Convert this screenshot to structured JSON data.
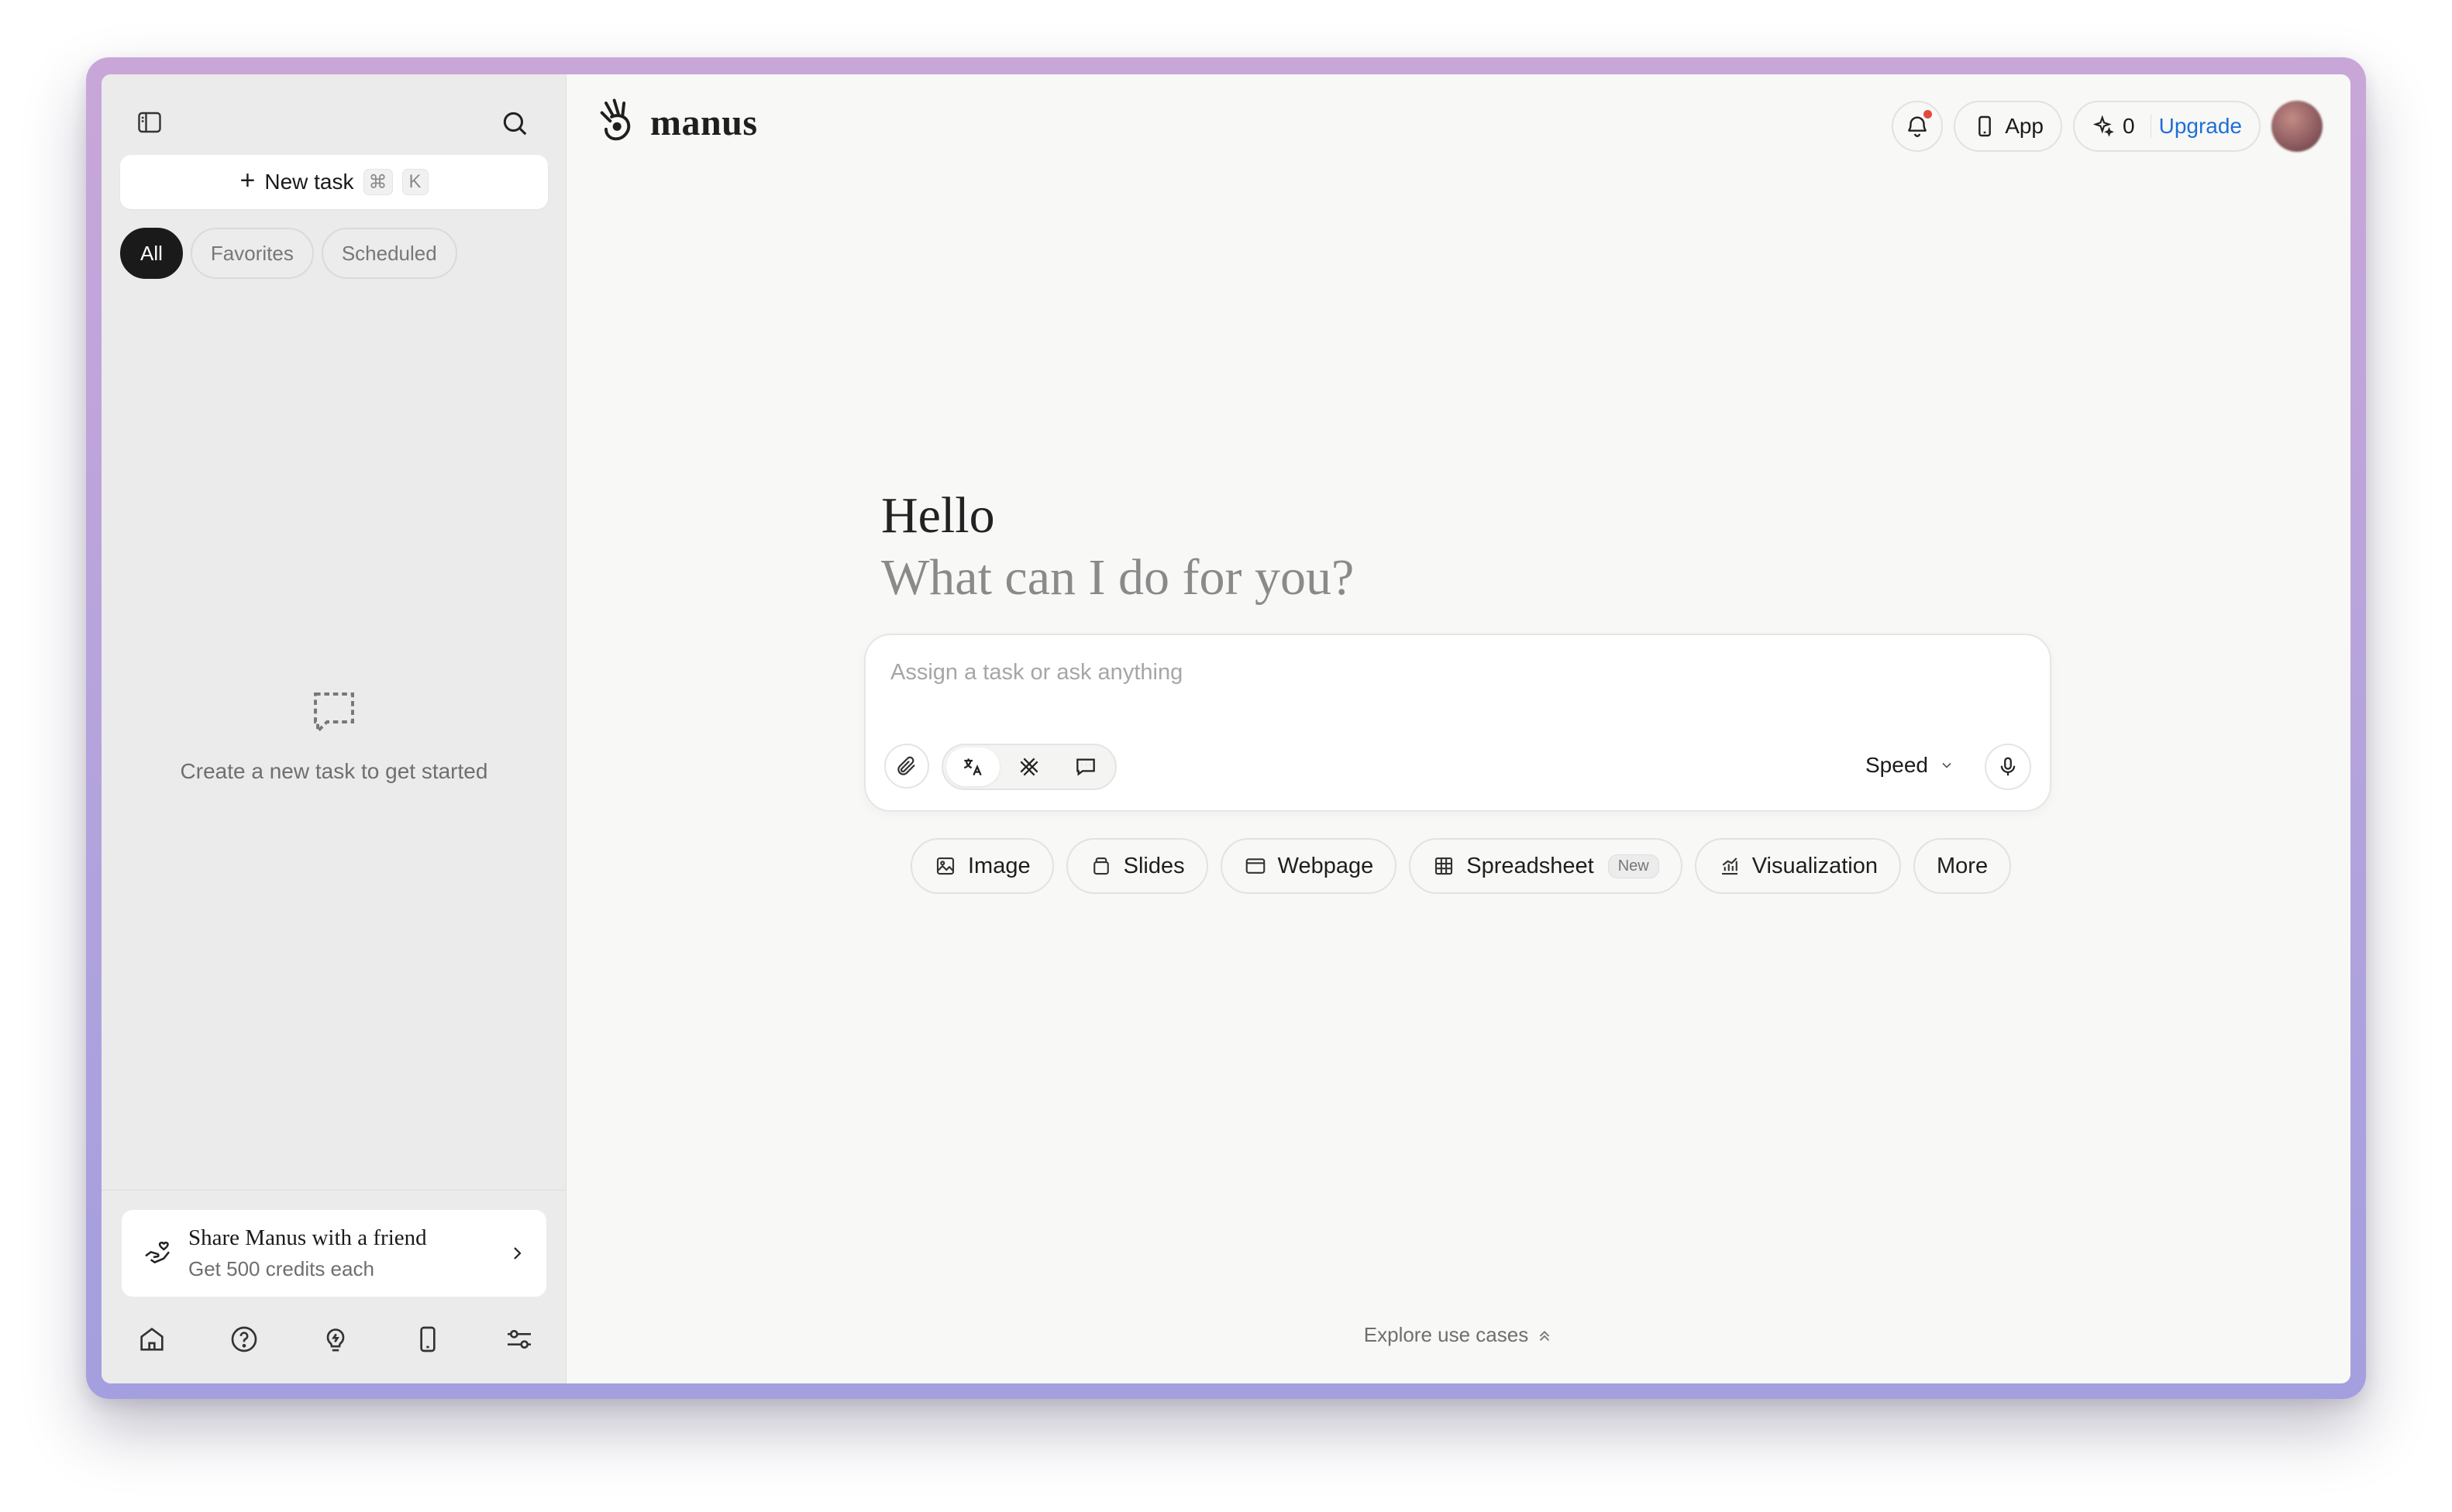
{
  "app": {
    "name": "manus"
  },
  "sidebar": {
    "new_task_label": "New task",
    "shortcut_key1": "⌘",
    "shortcut_key2": "K",
    "filters": [
      "All",
      "Favorites",
      "Scheduled"
    ],
    "active_filter": "All",
    "empty_text": "Create a new task to get started",
    "share": {
      "title": "Share Manus with a friend",
      "subtitle": "Get 500 credits each"
    },
    "bottom_icons": [
      "home-icon",
      "help-icon",
      "lightbulb-icon",
      "phone-icon",
      "settings-sliders-icon"
    ]
  },
  "header": {
    "app_button": "App",
    "credits": "0",
    "upgrade": "Upgrade",
    "notification_dot_color": "#e34a3f",
    "accent_color": "#1f6fd6"
  },
  "hero": {
    "greeting": "Hello",
    "prompt": "What can I do for you?"
  },
  "composer": {
    "placeholder": "Assign a task or ask anything",
    "mode": "Speed"
  },
  "actions": [
    {
      "label": "Image",
      "icon": "image-icon"
    },
    {
      "label": "Slides",
      "icon": "slides-icon"
    },
    {
      "label": "Webpage",
      "icon": "browser-icon"
    },
    {
      "label": "Spreadsheet",
      "icon": "table-icon",
      "badge": "New"
    },
    {
      "label": "Visualization",
      "icon": "chart-icon"
    },
    {
      "label": "More"
    }
  ],
  "footer": {
    "explore": "Explore use cases"
  }
}
